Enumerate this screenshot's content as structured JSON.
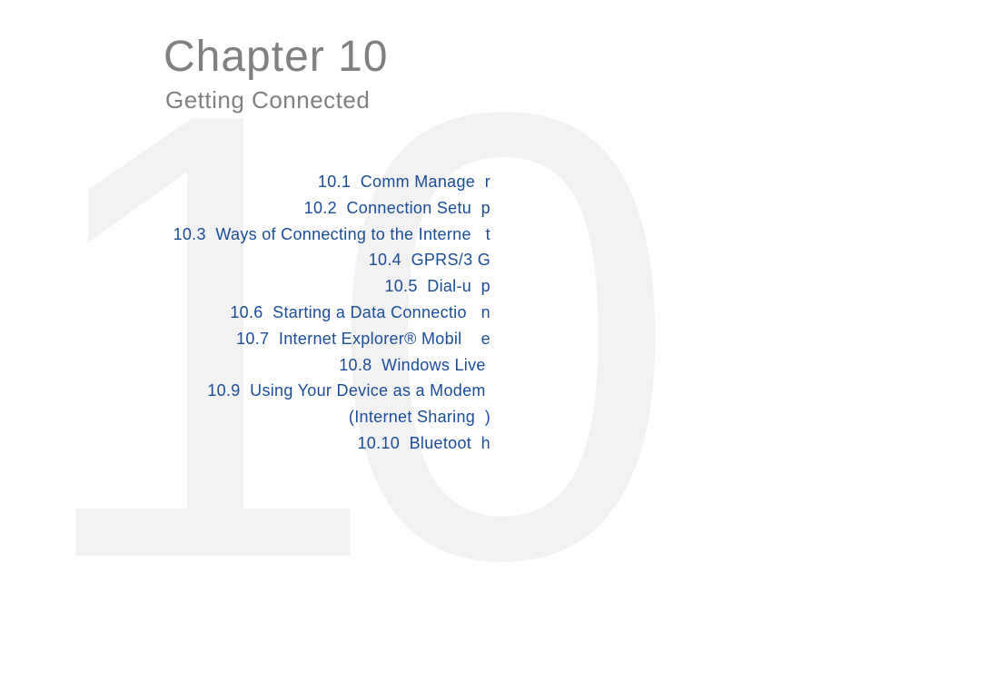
{
  "watermark": "10",
  "chapter_title": "Chapter 10",
  "subtitle": "Getting Connected",
  "toc": [
    "10.1  Comm Manage  r",
    "10.2  Connection Setu  p",
    "10.3  Ways of Connecting to the Interne   t",
    "10.4  GPRS/3 G",
    "10.5  Dial-u  p",
    "10.6  Starting a Data Connectio   n",
    "10.7  Internet Explorer® Mobil    e",
    "10.8  Windows Live ",
    "10.9  Using Your Device as a Modem ",
    "(Internet Sharing  )",
    "10.10  Bluetoot  h"
  ]
}
